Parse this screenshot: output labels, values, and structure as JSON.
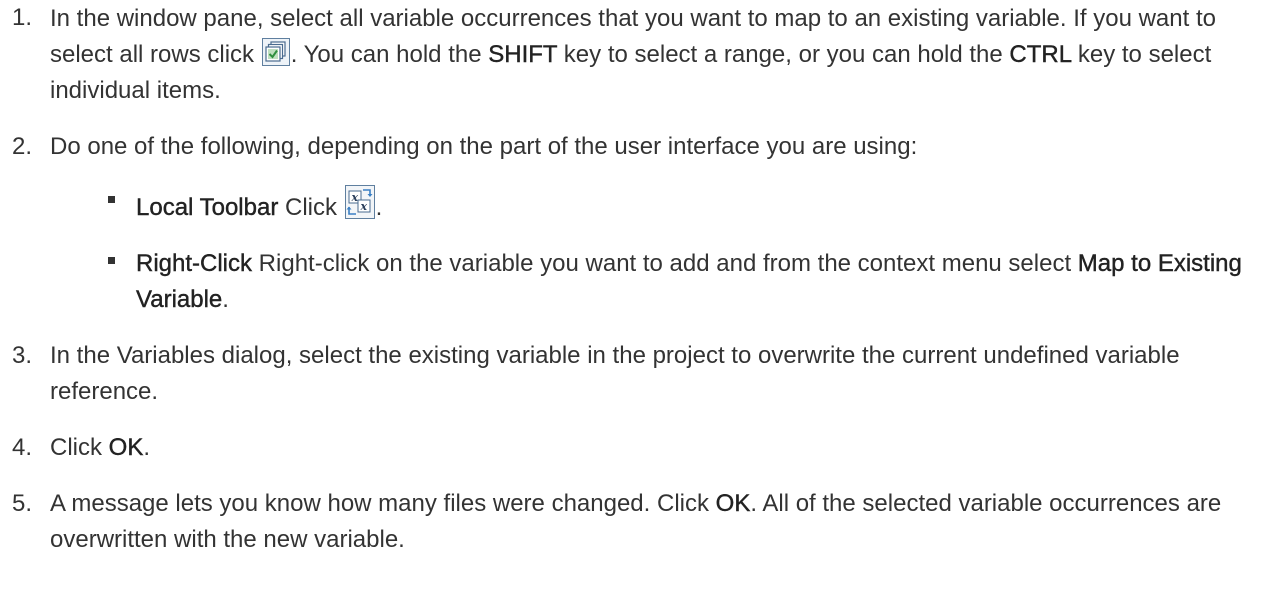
{
  "steps": [
    {
      "number": "1.",
      "text_a": "In the window pane, select all variable occurrences that you want to map to an existing variable. If you want to select all rows click ",
      "text_b": ". You can hold the ",
      "key1": "SHIFT",
      "text_c": " key to select a range, or you can hold the ",
      "key2": "CTRL",
      "text_d": " key to select individual items."
    },
    {
      "number": "2.",
      "text": "Do one of the following, depending on the part of the user interface you are using:",
      "options": [
        {
          "label": "Local Toolbar",
          "text_a": " Click ",
          "text_b": "."
        },
        {
          "label": "Right-Click",
          "text_a": " Right-click on the variable you want to add and from the context menu select ",
          "menu_item": "Map to Existing Variable",
          "text_b": "."
        }
      ]
    },
    {
      "number": "3.",
      "text": "In the Variables dialog, select the existing variable in the project to overwrite the current undefined variable reference."
    },
    {
      "number": "4.",
      "text_a": "Click ",
      "button": "OK",
      "text_b": "."
    },
    {
      "number": "5.",
      "text_a": "A message lets you know how many files were changed. Click ",
      "button": "OK",
      "text_b": ". All of the selected variable occurrences are overwritten with the new variable."
    }
  ],
  "icons": {
    "select_all": "select-all-rows-icon",
    "map_variable": "map-to-existing-variable-icon"
  },
  "colors": {
    "text": "#333333",
    "icon_blue": "#3a7fc4",
    "icon_green": "#3aa04a"
  }
}
